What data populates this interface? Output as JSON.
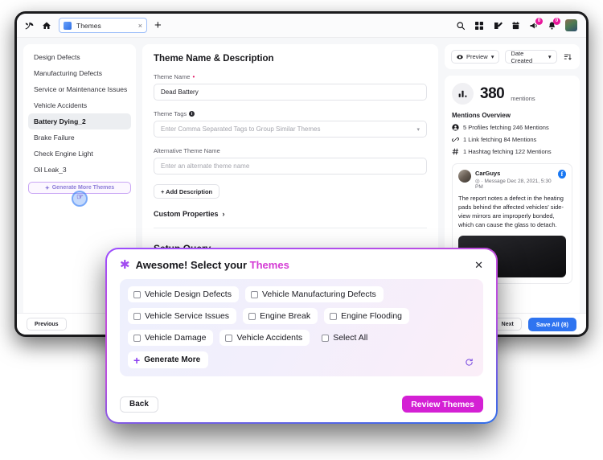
{
  "browser": {
    "tab": {
      "title": "Themes",
      "close_label": "×",
      "favicon": "themes-favicon"
    },
    "new_tab_label": "+",
    "left_icons": [
      {
        "name": "brand-logo-icon"
      },
      {
        "name": "home-icon"
      }
    ],
    "right_icons": [
      {
        "name": "search-icon",
        "badge": null
      },
      {
        "name": "apps-grid-icon",
        "badge": null
      },
      {
        "name": "compose-icon",
        "badge": null
      },
      {
        "name": "calendar-icon",
        "badge": null
      },
      {
        "name": "megaphone-icon",
        "badge": "0"
      },
      {
        "name": "bell-icon",
        "badge": "0"
      },
      {
        "name": "avatar",
        "badge": null
      }
    ]
  },
  "sidebar": {
    "items": [
      {
        "label": "Design Defects",
        "active": false
      },
      {
        "label": "Manufacturing Defects",
        "active": false
      },
      {
        "label": "Service or Maintenance Issues",
        "active": false
      },
      {
        "label": "Vehicle Accidents",
        "active": false
      },
      {
        "label": "Battery Dying_2",
        "active": true
      },
      {
        "label": "Brake Failure",
        "active": false
      },
      {
        "label": "Check Engine Light",
        "active": false
      },
      {
        "label": "Oil Leak_3",
        "active": false
      }
    ],
    "generate_button": "Generate More Themes"
  },
  "main": {
    "section_title": "Theme Name & Description",
    "theme_name": {
      "label": "Theme Name",
      "required_mark": "•",
      "value": "Dead Battery"
    },
    "theme_tags": {
      "label": "Theme Tags",
      "placeholder": "Enter Comma Separated Tags to Group Similar Themes"
    },
    "alt_name": {
      "label": "Alternative Theme Name",
      "placeholder": "Enter an alternate theme name"
    },
    "add_description_label": "+ Add Description",
    "custom_properties_label": "Custom Properties",
    "setup_query_title": "Setup Query"
  },
  "right_panel": {
    "preview_label": "Preview",
    "sort_label": "Date Created",
    "metric": {
      "value": "380",
      "unit": "mentions"
    },
    "overview_title": "Mentions Overview",
    "overview_lines": [
      {
        "icon": "profile-icon",
        "text": "5 Profiles fetching 246 Mentions"
      },
      {
        "icon": "link-icon",
        "text": "1 Link fetching 84 Mentions"
      },
      {
        "icon": "hashtag-icon",
        "text": "1 Hashtag fetching 122 Mentions"
      }
    ],
    "post": {
      "author": "CarGuys",
      "meta": "◎ · Message Dec 28, 2021, 5:30 PM",
      "network_icon": "facebook-icon",
      "body": "The report notes a defect in the heating pads behind the affected vehicles' side-view mirrors are improperly bonded, which can cause the glass to detach."
    }
  },
  "bottom_bar": {
    "previous_label": "Previous",
    "next_label": "Next",
    "save_all_label": "Save All (8)"
  },
  "modal": {
    "title_prefix": "Awesome! Select your ",
    "title_accent": "Themes",
    "close_label": "✕",
    "rows": [
      [
        {
          "label": "Vehicle Design Defects",
          "checked": false,
          "plain": false
        },
        {
          "label": "Vehicle Manufacturing Defects",
          "checked": false,
          "plain": false
        }
      ],
      [
        {
          "label": "Vehicle Service Issues",
          "checked": false,
          "plain": false
        },
        {
          "label": "Engine Break",
          "checked": false,
          "plain": false
        },
        {
          "label": "Engine Flooding",
          "checked": false,
          "plain": false
        }
      ],
      [
        {
          "label": "Vehicle Damage",
          "checked": false,
          "plain": false
        },
        {
          "label": "Vehicle Accidents",
          "checked": false,
          "plain": false
        },
        {
          "label": "Select All",
          "checked": false,
          "plain": true
        }
      ]
    ],
    "generate_more_label": "Generate More",
    "back_label": "Back",
    "review_label": "Review Themes"
  },
  "colors": {
    "accent_magenta": "#d420d4",
    "accent_purple": "#8b3df0",
    "accent_blue": "#2f74f0",
    "badge_pink": "#e8189b"
  }
}
